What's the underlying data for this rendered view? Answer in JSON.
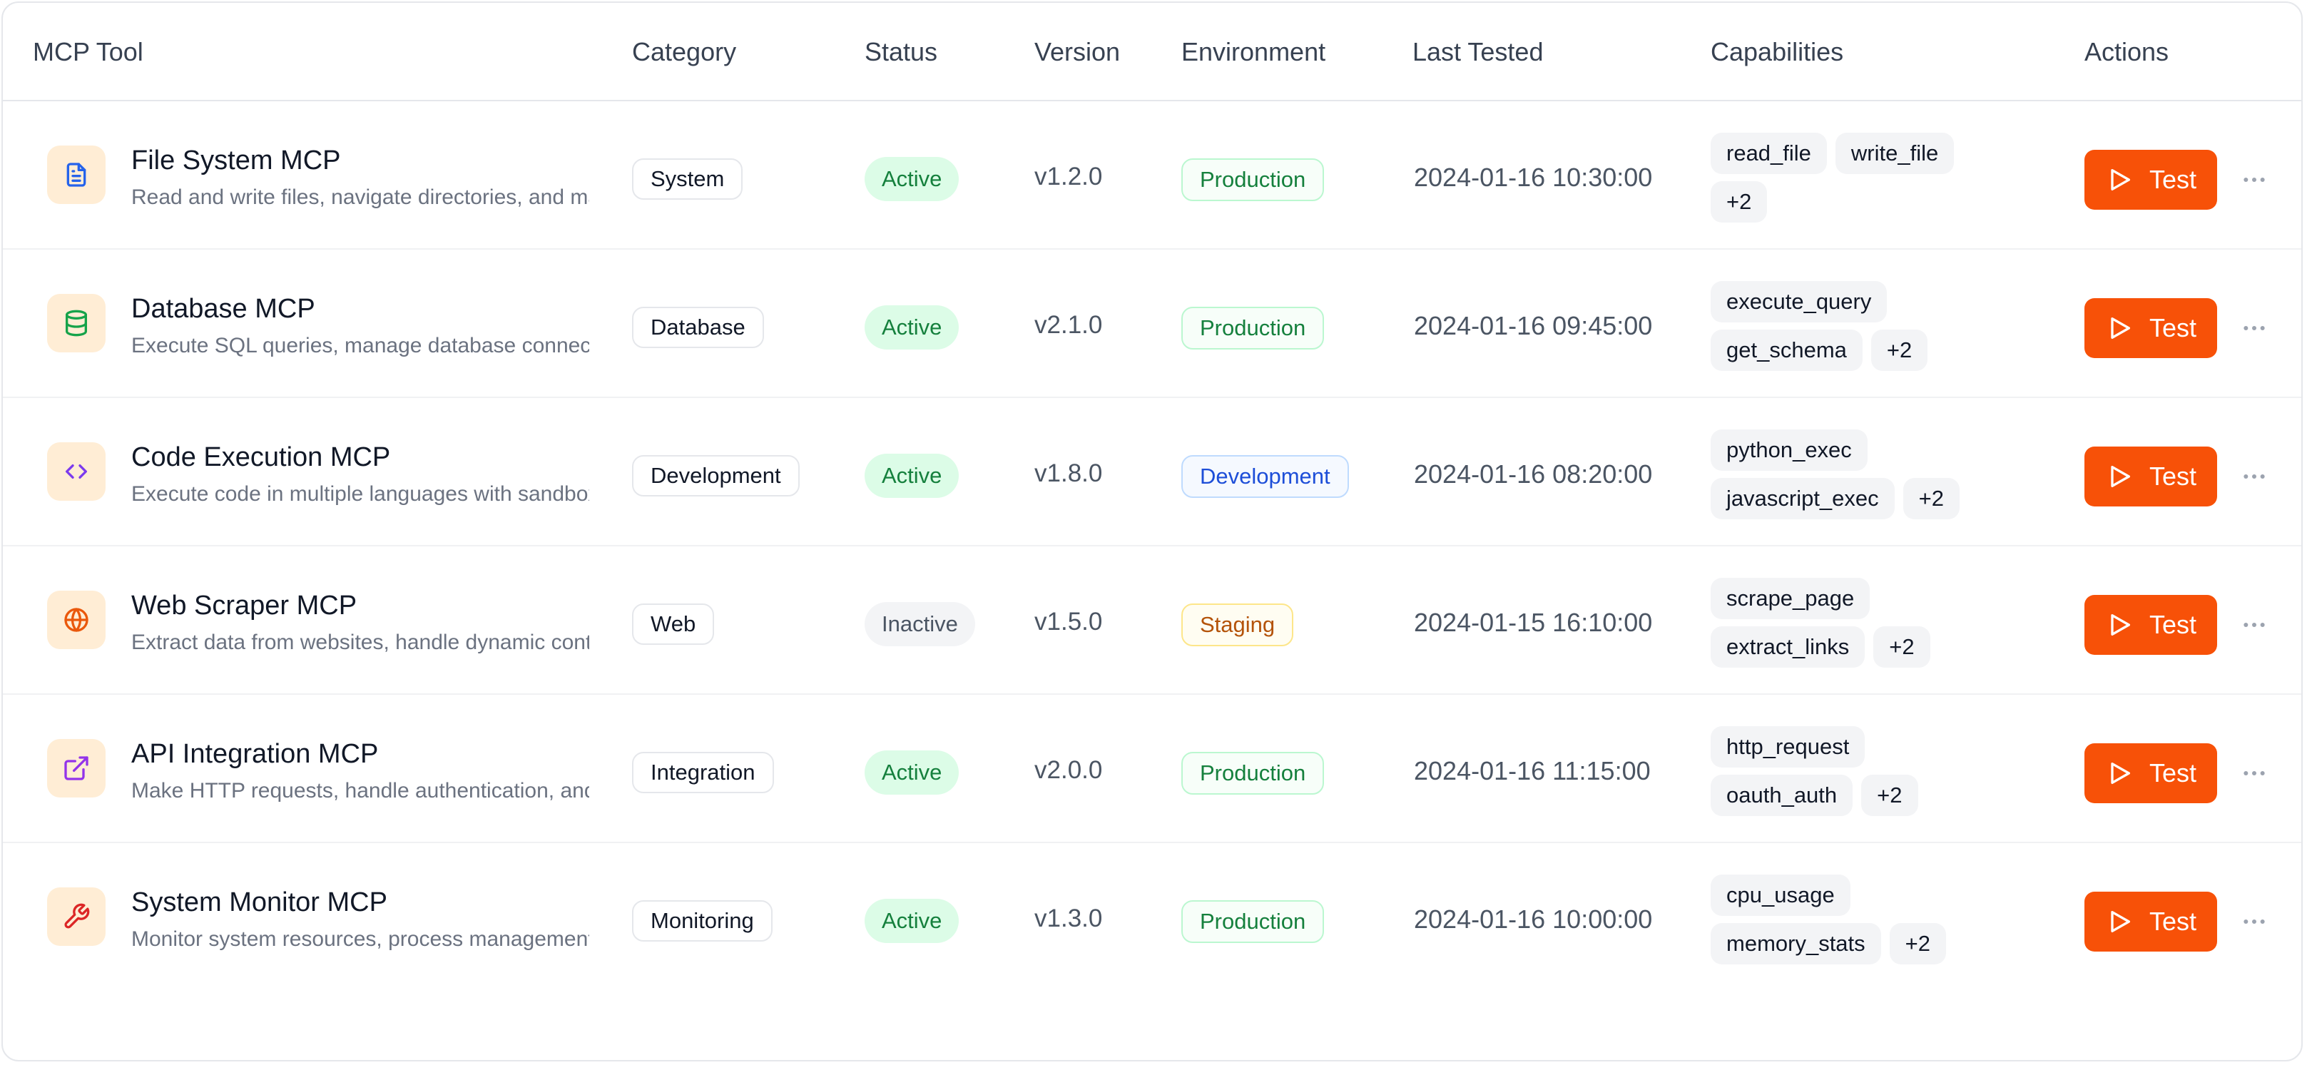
{
  "columns": {
    "tool": "MCP Tool",
    "category": "Category",
    "status": "Status",
    "version": "Version",
    "environment": "Environment",
    "last_tested": "Last Tested",
    "capabilities": "Capabilities",
    "actions": "Actions"
  },
  "test_label": "Test",
  "rows": [
    {
      "name": "File System MCP",
      "description": "Read and write files, navigate directories, and manage file permissions",
      "icon": "file-icon",
      "icon_color": "#2563eb",
      "category": "System",
      "status": "Active",
      "version": "v1.2.0",
      "environment": "Production",
      "last_tested": "2024-01-16 10:30:00",
      "capabilities": [
        "read_file",
        "write_file"
      ],
      "more_caps": "+2"
    },
    {
      "name": "Database MCP",
      "description": "Execute SQL queries, manage database connections and schemas",
      "icon": "database-icon",
      "icon_color": "#16a34a",
      "category": "Database",
      "status": "Active",
      "version": "v2.1.0",
      "environment": "Production",
      "last_tested": "2024-01-16 09:45:00",
      "capabilities": [
        "execute_query",
        "get_schema"
      ],
      "more_caps": "+2"
    },
    {
      "name": "Code Execution MCP",
      "description": "Execute code in multiple languages with sandboxed environments",
      "icon": "code-icon",
      "icon_color": "#7c3aed",
      "category": "Development",
      "status": "Active",
      "version": "v1.8.0",
      "environment": "Development",
      "last_tested": "2024-01-16 08:20:00",
      "capabilities": [
        "python_exec",
        "javascript_exec"
      ],
      "more_caps": "+2"
    },
    {
      "name": "Web Scraper MCP",
      "description": "Extract data from websites, handle dynamic content and pagination",
      "icon": "globe-icon",
      "icon_color": "#ea580c",
      "category": "Web",
      "status": "Inactive",
      "version": "v1.5.0",
      "environment": "Staging",
      "last_tested": "2024-01-15 16:10:00",
      "capabilities": [
        "scrape_page",
        "extract_links"
      ],
      "more_caps": "+2"
    },
    {
      "name": "API Integration MCP",
      "description": "Make HTTP requests, handle authentication, and parse responses",
      "icon": "external-link-icon",
      "icon_color": "#9333ea",
      "category": "Integration",
      "status": "Active",
      "version": "v2.0.0",
      "environment": "Production",
      "last_tested": "2024-01-16 11:15:00",
      "capabilities": [
        "http_request",
        "oauth_auth"
      ],
      "more_caps": "+2"
    },
    {
      "name": "System Monitor MCP",
      "description": "Monitor system resources, process management and performance metrics",
      "icon": "wrench-icon",
      "icon_color": "#dc2626",
      "category": "Monitoring",
      "status": "Active",
      "version": "v1.3.0",
      "environment": "Production",
      "last_tested": "2024-01-16 10:00:00",
      "capabilities": [
        "cpu_usage",
        "memory_stats"
      ],
      "more_caps": "+2"
    }
  ]
}
